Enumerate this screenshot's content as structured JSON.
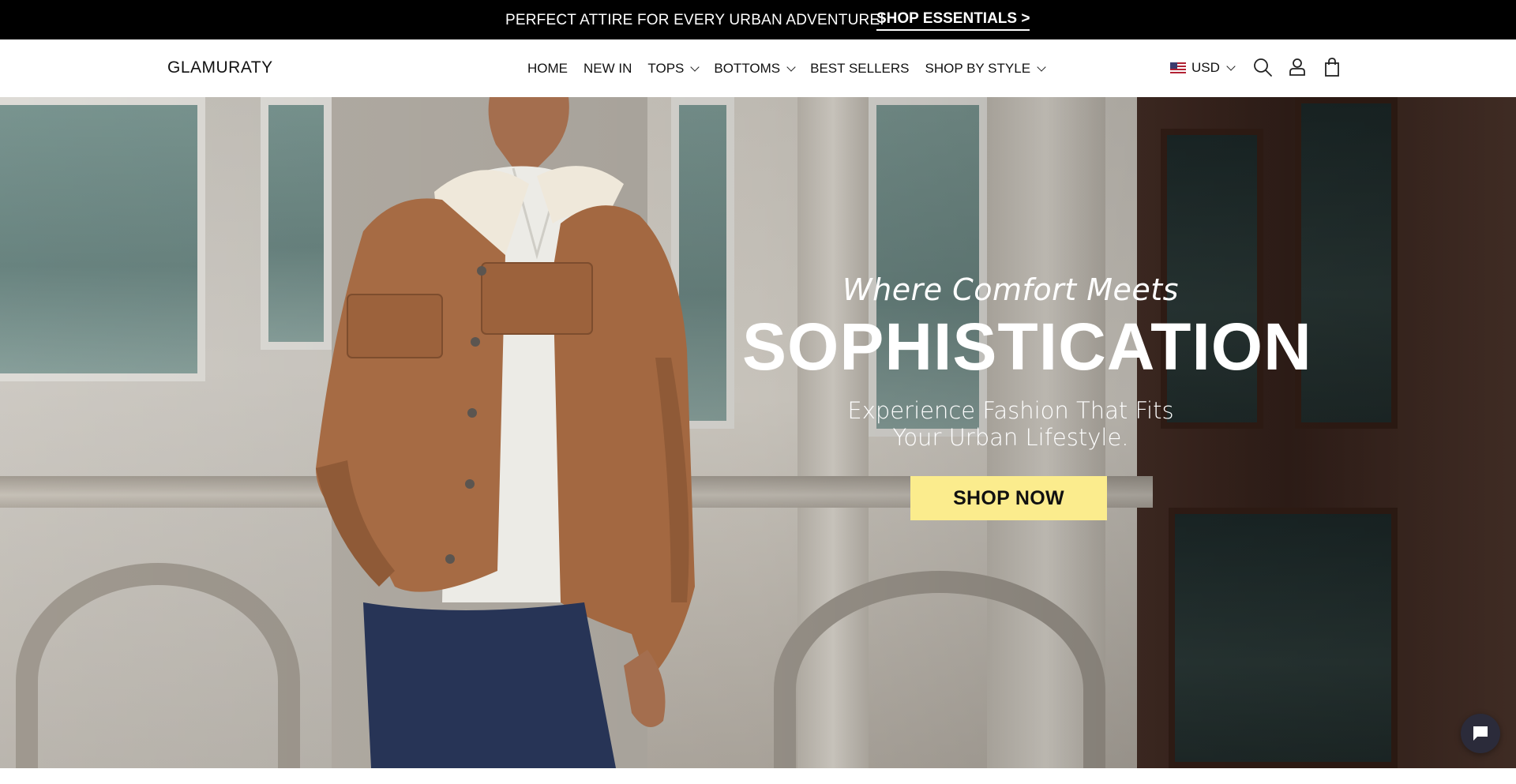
{
  "announcement": {
    "message": "PERFECT ATTIRE FOR EVERY URBAN ADVENTURE!",
    "cta_label": "SHOP ESSENTIALS >"
  },
  "header": {
    "logo": "GLAMURATY",
    "nav": [
      {
        "label": "HOME",
        "has_dropdown": false
      },
      {
        "label": "NEW IN",
        "has_dropdown": false
      },
      {
        "label": "TOPS",
        "has_dropdown": true
      },
      {
        "label": "BOTTOMS",
        "has_dropdown": true
      },
      {
        "label": "BEST SELLERS",
        "has_dropdown": false
      },
      {
        "label": "SHOP BY STYLE",
        "has_dropdown": true
      }
    ],
    "currency": "USD",
    "icons": [
      "us-flag-icon",
      "search-icon",
      "account-icon",
      "cart-icon"
    ]
  },
  "hero": {
    "kicker": "Where Comfort Meets",
    "title": "SOPHISTICATION",
    "subtitle_line1": "Experience Fashion That Fits",
    "subtitle_line2": "Your Urban Lifestyle.",
    "cta_label": "SHOP NOW"
  },
  "colors": {
    "announcement_bg": "#000000",
    "cta_bg": "#fbec8d",
    "text_dark": "#111111",
    "chat_bg": "#2b2b3a"
  }
}
